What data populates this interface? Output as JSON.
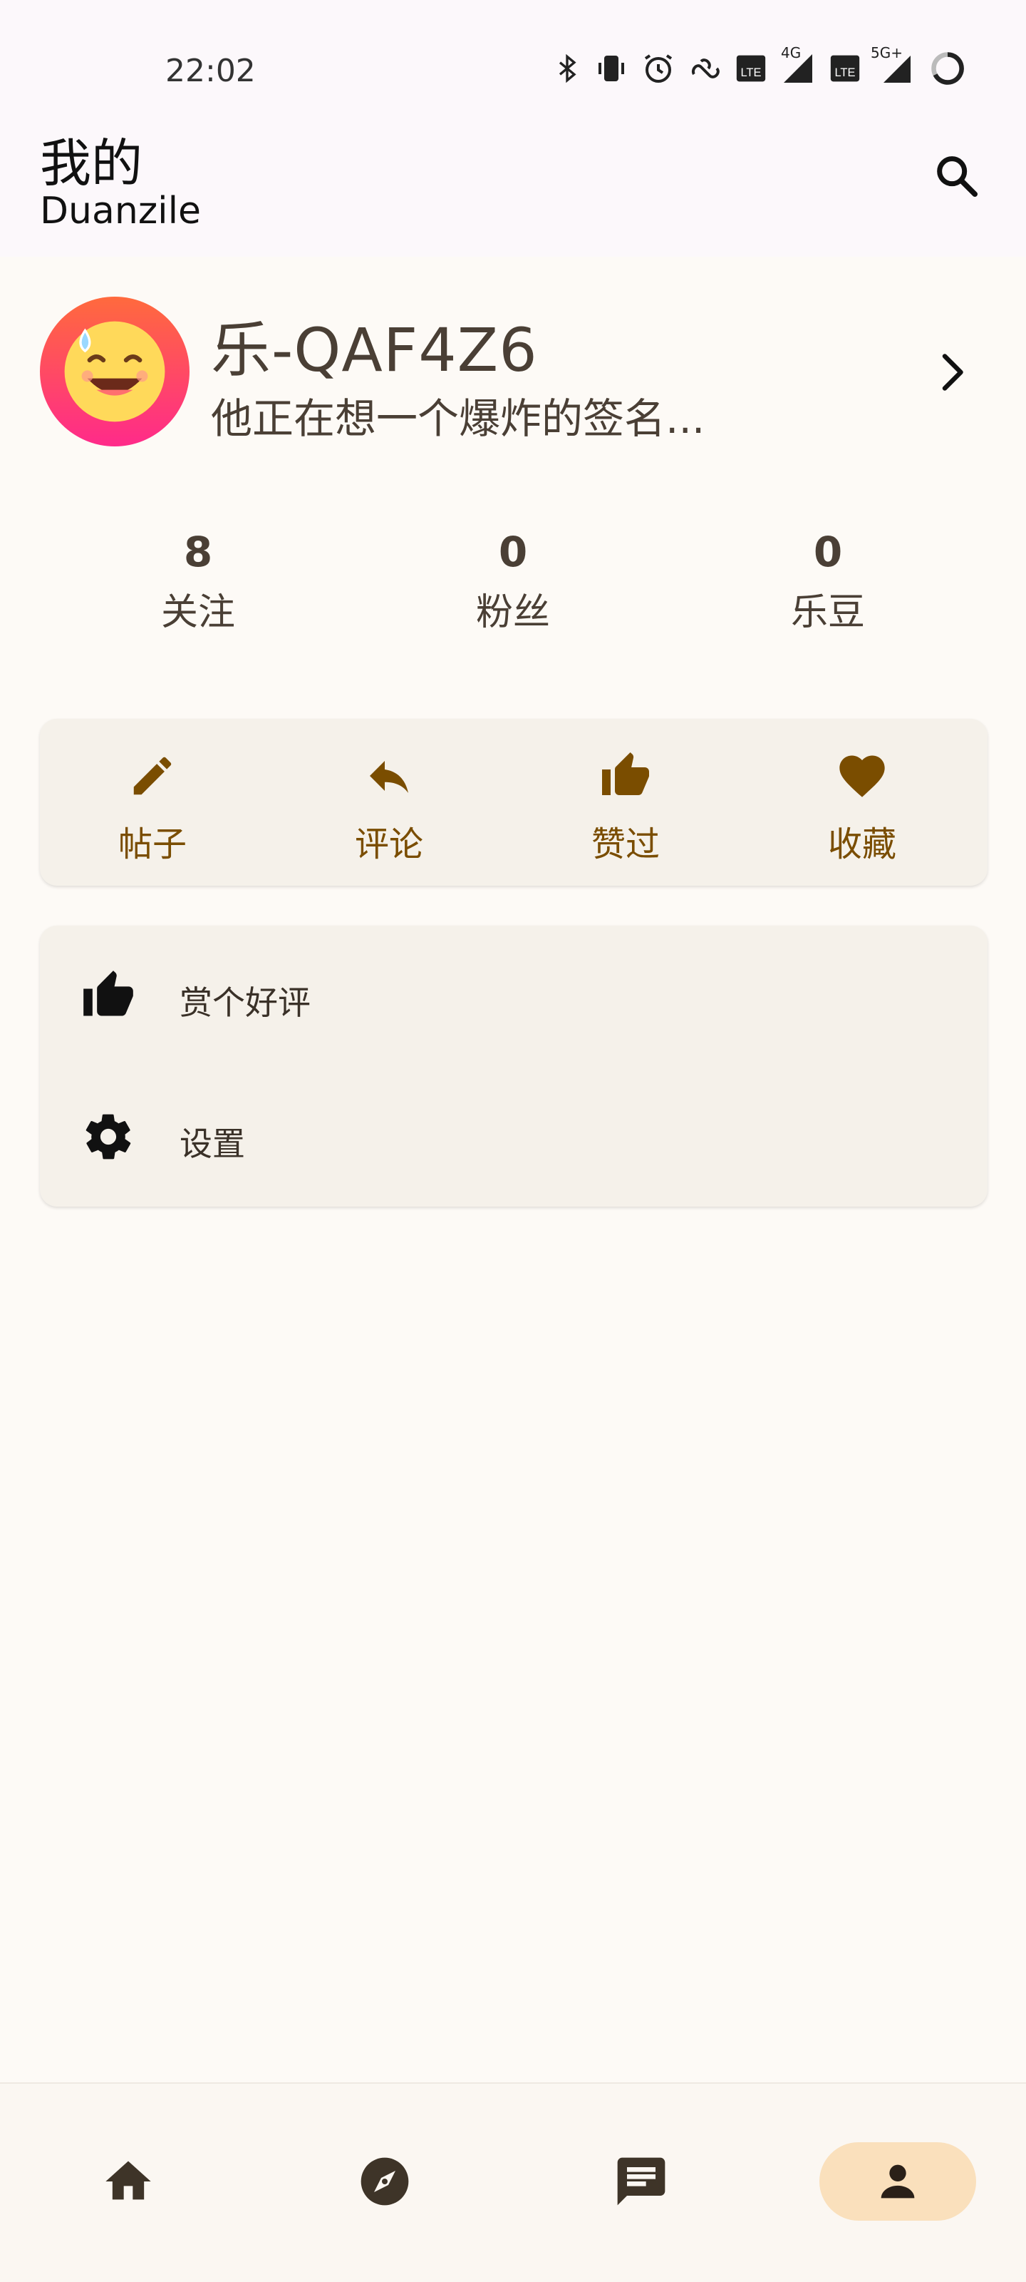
{
  "status_bar": {
    "time": "22:02",
    "icons": [
      "bluetooth-icon",
      "vibrate-icon",
      "alarm-icon",
      "link-icon",
      "volte-icon",
      "signal-4g-icon",
      "volte-icon",
      "signal-5g-icon",
      "battery-icon"
    ],
    "network_labels": [
      "4G",
      "5G+"
    ]
  },
  "app_bar": {
    "title": "我的",
    "subtitle": "Duanzile",
    "search_icon": "search-icon"
  },
  "profile": {
    "avatar_icon": "emoji-sweat-smile-icon",
    "username": "乐-QAF4Z6",
    "signature": "他正在想一个爆炸的签名...",
    "chevron_icon": "chevron-right-icon"
  },
  "stats": [
    {
      "value": "8",
      "label": "关注"
    },
    {
      "value": "0",
      "label": "粉丝"
    },
    {
      "value": "0",
      "label": "乐豆"
    }
  ],
  "actions": [
    {
      "label": "帖子",
      "icon": "pencil-icon"
    },
    {
      "label": "评论",
      "icon": "reply-icon"
    },
    {
      "label": "赞过",
      "icon": "thumb-up-icon"
    },
    {
      "label": "收藏",
      "icon": "heart-icon"
    }
  ],
  "menu": [
    {
      "label": "赏个好评",
      "icon": "thumb-up-icon"
    },
    {
      "label": "设置",
      "icon": "gear-icon"
    }
  ],
  "bottom_nav": [
    {
      "icon": "home-icon",
      "active": false
    },
    {
      "icon": "compass-icon",
      "active": false
    },
    {
      "icon": "message-icon",
      "active": false
    },
    {
      "icon": "person-icon",
      "active": true
    }
  ],
  "colors": {
    "accent": "#7a4d00",
    "nav_active_bg": "#fae0bc",
    "card_bg": "#f5f1ea",
    "page_bg": "#fdfaf6"
  }
}
